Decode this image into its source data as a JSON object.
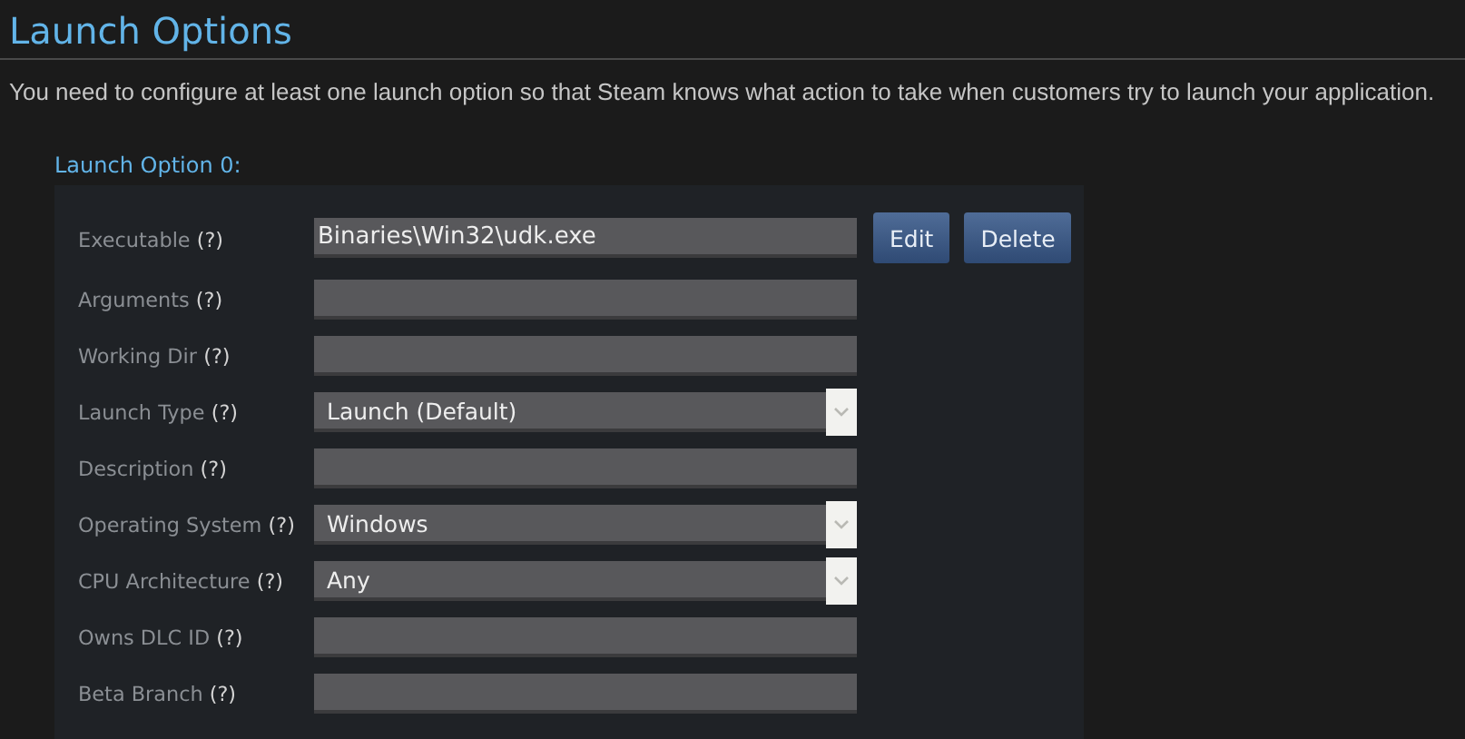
{
  "title": "Launch Options",
  "description": "You need to configure at least one launch option so that Steam knows what action to take when customers try to launch your application.",
  "section": {
    "label": "Launch Option 0:",
    "fields": [
      {
        "label": "Executable **(?)**",
        "kind": "text",
        "value": "Binaries\\Win32\\udk.exe"
      },
      {
        "label": "Arguments **(?)**",
        "kind": "text"
      },
      {
        "label": "Working Dir **(?)**",
        "kind": "text"
      },
      {
        "label": "Launch Type **(?)**",
        "kind": "select",
        "value": "Launch (Default)"
      },
      {
        "label": "Description **(?)**",
        "kind": "text"
      },
      {
        "label": "Operating System **(?)**",
        "kind": "select",
        "value": "Windows"
      },
      {
        "label": "CPU Architecture **(?)**",
        "kind": "select",
        "value": "Any"
      },
      {
        "label": "Owns DLC ID **(?)**",
        "kind": "text"
      },
      {
        "label": "Beta Branch **(?)**",
        "kind": "text"
      }
    ],
    "buttons": [
      "Edit",
      "Delete"
    ]
  }
}
